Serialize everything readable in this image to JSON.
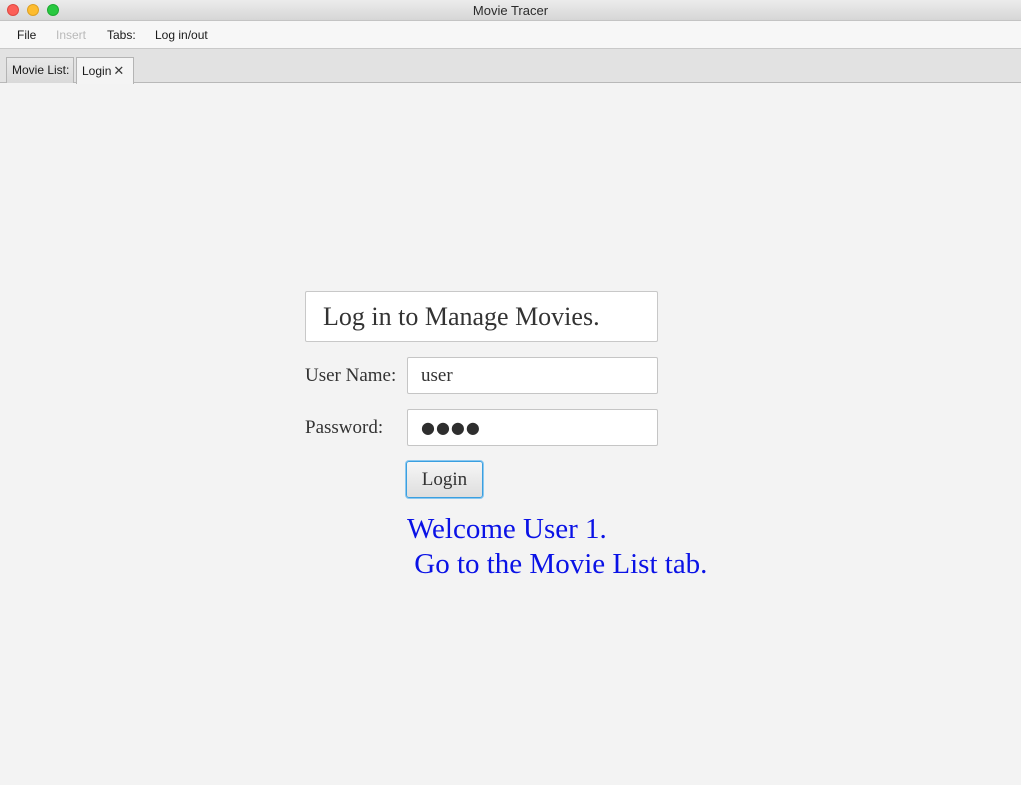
{
  "window": {
    "title": "Movie Tracer"
  },
  "menubar": {
    "items": [
      {
        "label": "File",
        "enabled": true
      },
      {
        "label": "Insert",
        "enabled": false
      },
      {
        "label": "Tabs:",
        "enabled": true
      },
      {
        "label": "Log in/out",
        "enabled": true
      }
    ]
  },
  "tabs": {
    "items": [
      {
        "label": "Movie List:",
        "closable": false,
        "selected": false
      },
      {
        "label": "Login",
        "closable": true,
        "selected": true
      }
    ],
    "close_glyph": "✕"
  },
  "login": {
    "heading": "Log in to Manage Movies.",
    "username_label": "User Name:",
    "username_value": "user",
    "password_label": "Password:",
    "password_masked": "●●●●",
    "button_label": "Login",
    "welcome_line1": "Welcome User 1.",
    "welcome_line2": " Go to the Movie List tab."
  },
  "colors": {
    "welcome_text": "#0a12e6",
    "focus_ring": "#3a9fe0",
    "close_button": "#fc5f57",
    "minimize_button": "#fdbc2e",
    "maximize_button": "#28c840"
  }
}
